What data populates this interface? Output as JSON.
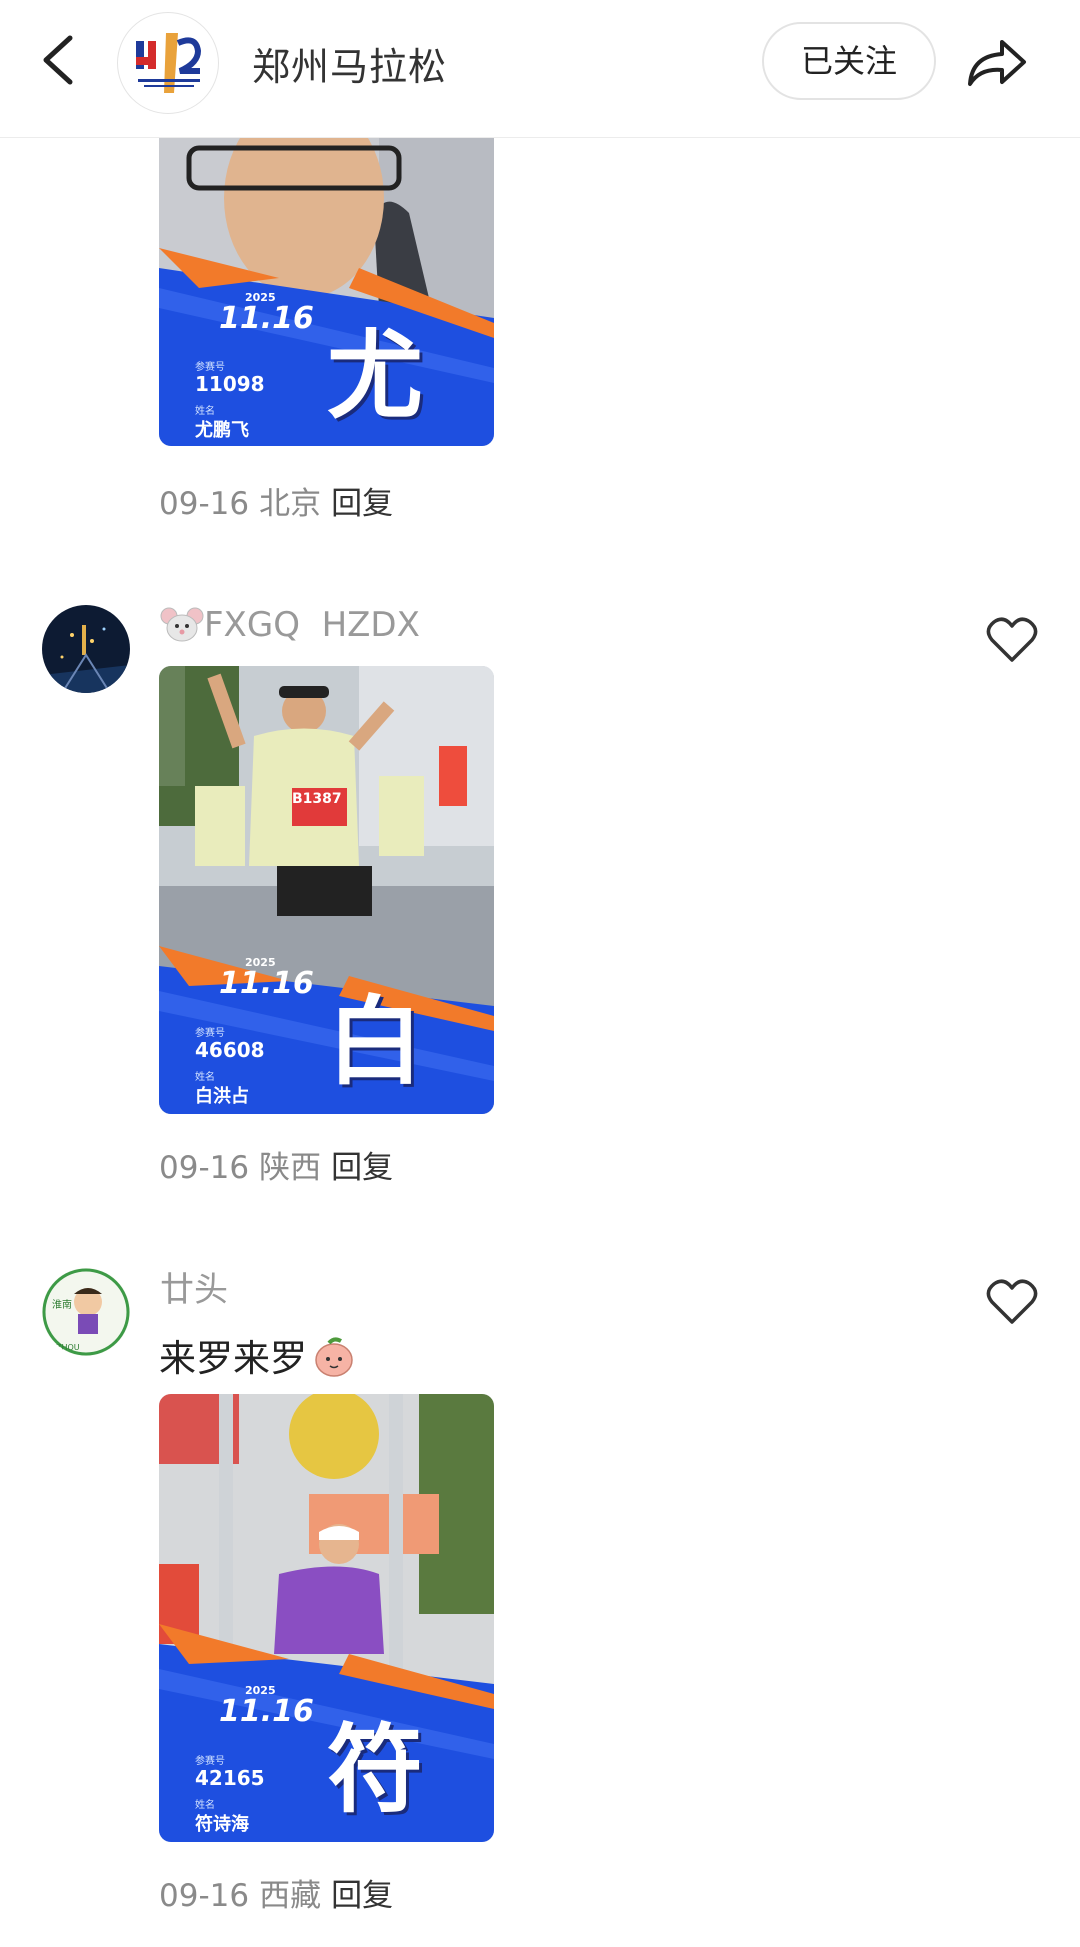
{
  "header": {
    "title": "郑州马拉松",
    "follow_label": "已关注",
    "logo_text": "郑州马拉松 ZHENGZHOU MARATHON"
  },
  "posts": [
    {
      "image": {
        "race_date": "11.16",
        "year": "2025",
        "bib_label": "参赛号",
        "bib": "11098",
        "name_label": "姓名",
        "name": "尤鹏飞",
        "char": "尤"
      },
      "date": "09-16",
      "location": "北京",
      "reply_label": "回复"
    },
    {
      "user": "FXGQ  HZDX",
      "image": {
        "race_date": "11.16",
        "year": "2025",
        "bib_label": "参赛号",
        "bib": "46608",
        "name_label": "姓名",
        "name": "白洪占",
        "char": "白",
        "shirt_bib": "B1387"
      },
      "date": "09-16",
      "location": "陕西",
      "reply_label": "回复"
    },
    {
      "user": "廿头",
      "text": "来罗来罗",
      "image": {
        "race_date": "11.16",
        "year": "2025",
        "bib_label": "参赛号",
        "bib": "42165",
        "name_label": "姓名",
        "name": "符诗海",
        "char": "符"
      },
      "date": "09-16",
      "location": "西藏",
      "reply_label": "回复"
    }
  ],
  "icons": {
    "back": "chevron-left-icon",
    "share": "share-arrow-icon",
    "like": "heart-outline-icon",
    "mouse_emoji": "mouse-face-emoji",
    "peach_emoji": "peach-emoji"
  },
  "colors": {
    "banner_blue": "#1e4fe0",
    "banner_orange": "#f27a2a",
    "muted": "#8a8a8a"
  }
}
